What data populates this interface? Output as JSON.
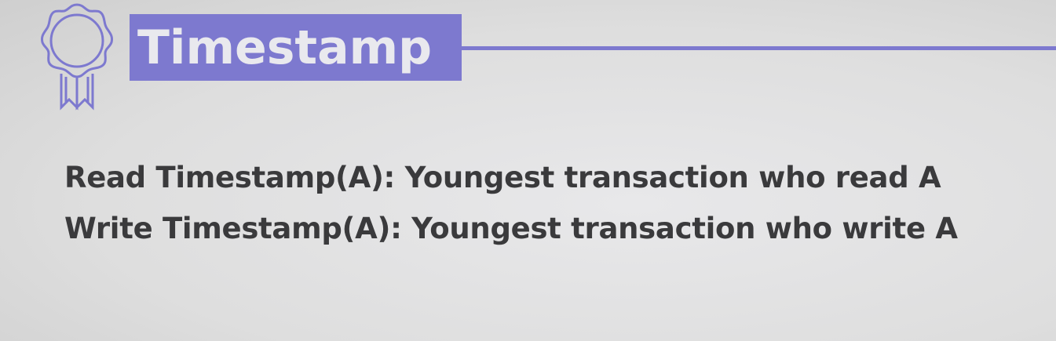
{
  "slide": {
    "title": "Timestamp",
    "icon": "award-ribbon-icon",
    "accent_color": "#7d79cf",
    "lines": [
      "Read Timestamp(A): Youngest transaction who read A",
      "Write Timestamp(A): Youngest transaction who write A"
    ]
  }
}
